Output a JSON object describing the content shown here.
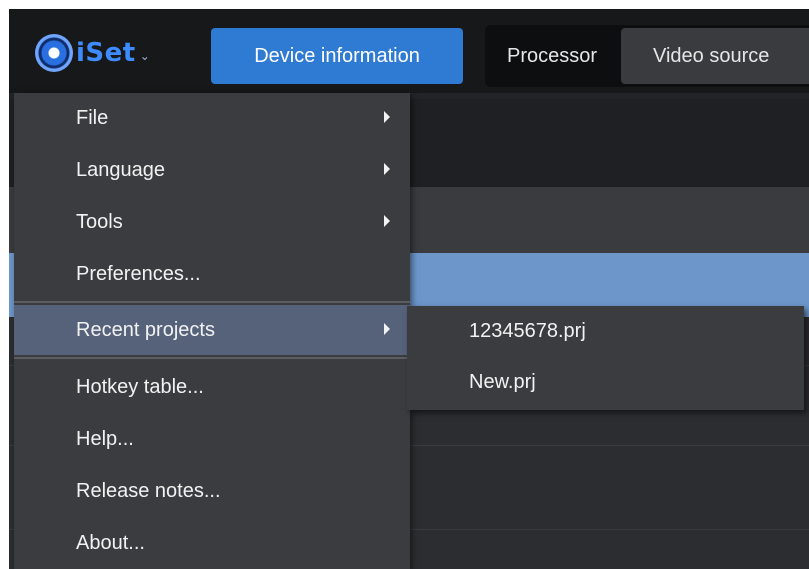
{
  "header": {
    "logo_text": "iSet",
    "logo_caret": "⌄",
    "device_info_label": "Device information",
    "tabs": [
      "Processor",
      "Video source"
    ]
  },
  "menu": {
    "items": [
      {
        "label": "File",
        "has_submenu": true
      },
      {
        "label": "Language",
        "has_submenu": true
      },
      {
        "label": "Tools",
        "has_submenu": true
      },
      {
        "label": "Preferences...",
        "has_submenu": false
      },
      {
        "label": "Recent projects",
        "has_submenu": true,
        "active": true
      },
      {
        "label": "Hotkey table...",
        "has_submenu": false
      },
      {
        "label": "Help...",
        "has_submenu": false
      },
      {
        "label": "Release notes...",
        "has_submenu": false
      },
      {
        "label": "About...",
        "has_submenu": false
      }
    ]
  },
  "submenu": {
    "items": [
      {
        "label": "12345678.prj"
      },
      {
        "label": "New.prj"
      }
    ]
  },
  "colors": {
    "accent": "#2f7bd3",
    "logo": "#3d8bff",
    "menu_bg": "#3b3c3f",
    "menu_active": "#55627a",
    "selected_row": "#6d97cb"
  }
}
